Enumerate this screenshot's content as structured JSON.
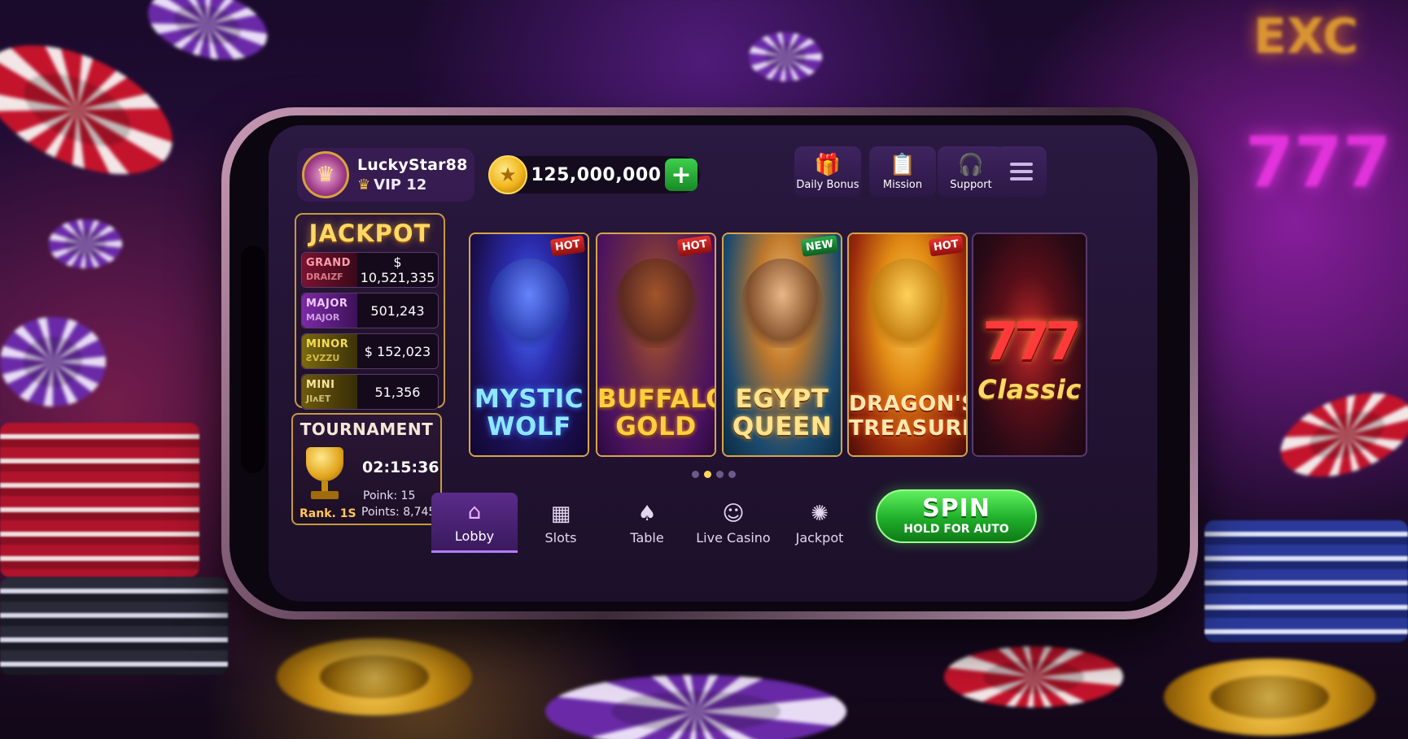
{
  "profile": {
    "username": "LuckyStar88",
    "vip": "VIP 12"
  },
  "balance": {
    "amount": "125,000,000",
    "add_label": "+"
  },
  "top_buttons": [
    {
      "label": "Daily Bonus",
      "icon": "gift-icon"
    },
    {
      "label": "Mission",
      "icon": "clipboard-icon"
    },
    {
      "label": "Support",
      "icon": "headset-icon"
    }
  ],
  "jackpot": {
    "title": "JACKPOT",
    "tiers": [
      {
        "name": "GRAND",
        "sub": "DRAIZF",
        "value": "$ 10,521,335"
      },
      {
        "name": "MAJOR",
        "sub": "MAJOR",
        "value": "501,243"
      },
      {
        "name": "MINOR",
        "sub": "ƧVZZU",
        "value": "$ 152,023"
      },
      {
        "name": "MINI",
        "sub": "JIʌET",
        "value": "51,356"
      }
    ]
  },
  "tournament": {
    "title": "TOURNAMENT",
    "timer": "02:15:36",
    "rank": "Rank. 1S",
    "poink": "Poink:  15",
    "points": "Points: 8,745"
  },
  "games": [
    {
      "title_line1": "MYSTIC",
      "title_line2": "WOLF",
      "badge": "HOT"
    },
    {
      "title_line1": "BUFFALO",
      "title_line2": "GOLD",
      "badge": "HOT"
    },
    {
      "title_line1": "EGYPT",
      "title_line2": "QUEEN",
      "badge": "NEW"
    },
    {
      "title_line1": "DRAGON'S",
      "title_line2": "TREASURE",
      "badge": "HOT"
    },
    {
      "title_line1": "777",
      "title_line2": "Classic",
      "badge": ""
    }
  ],
  "nav": [
    {
      "label": "Lobby",
      "icon": "house-icon"
    },
    {
      "label": "Slots",
      "icon": "slots-icon"
    },
    {
      "label": "Table",
      "icon": "cards-icon"
    },
    {
      "label": "Live Casino",
      "icon": "dealer-icon"
    },
    {
      "label": "Jackpot",
      "icon": "jackpot-icon"
    }
  ],
  "spin": {
    "label": "SPIN",
    "sublabel": "HOLD FOR AUTO"
  },
  "colors": {
    "accent": "#ffd863",
    "spin_green": "#1fae2a",
    "panel": "#2a1940"
  }
}
